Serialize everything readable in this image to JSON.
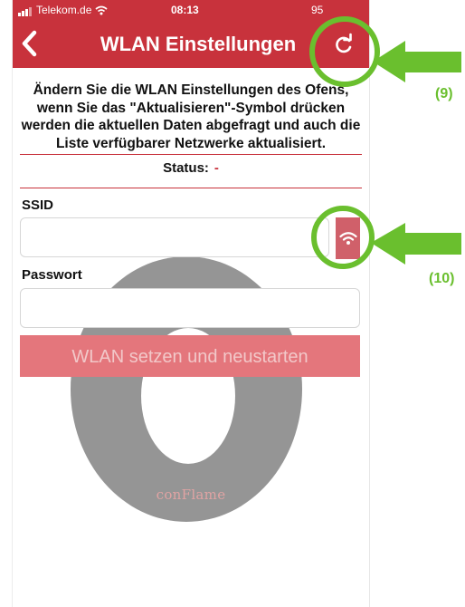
{
  "status_bar": {
    "carrier": "Telekom.de",
    "time": "08:13",
    "battery": "95"
  },
  "nav": {
    "title": "WLAN Einstellungen",
    "back_icon": "chevron-left-icon",
    "refresh_icon": "refresh-icon"
  },
  "intro": {
    "text": "Ändern Sie die WLAN Einstellungen des Ofens, wenn Sie das \"Aktualisieren\"-Symbol drücken werden die aktuellen Daten abgefragt und auch die Liste verfügbarer Netzwerke aktualisiert."
  },
  "status": {
    "label": "Status:",
    "value": "-"
  },
  "form": {
    "ssid_label": "SSID",
    "ssid_value": "",
    "password_label": "Passwort",
    "password_value": "",
    "wifi_icon": "wifi-icon",
    "submit_label": "WLAN setzen und neustarten"
  },
  "watermark": {
    "brand": "conFlame"
  },
  "annotations": {
    "refresh_callout": "(9)",
    "wifi_callout": "(10)"
  },
  "colors": {
    "brand_red": "#c8323c",
    "callout_green": "#6abf2e",
    "button_disabled": "#e4767c"
  }
}
